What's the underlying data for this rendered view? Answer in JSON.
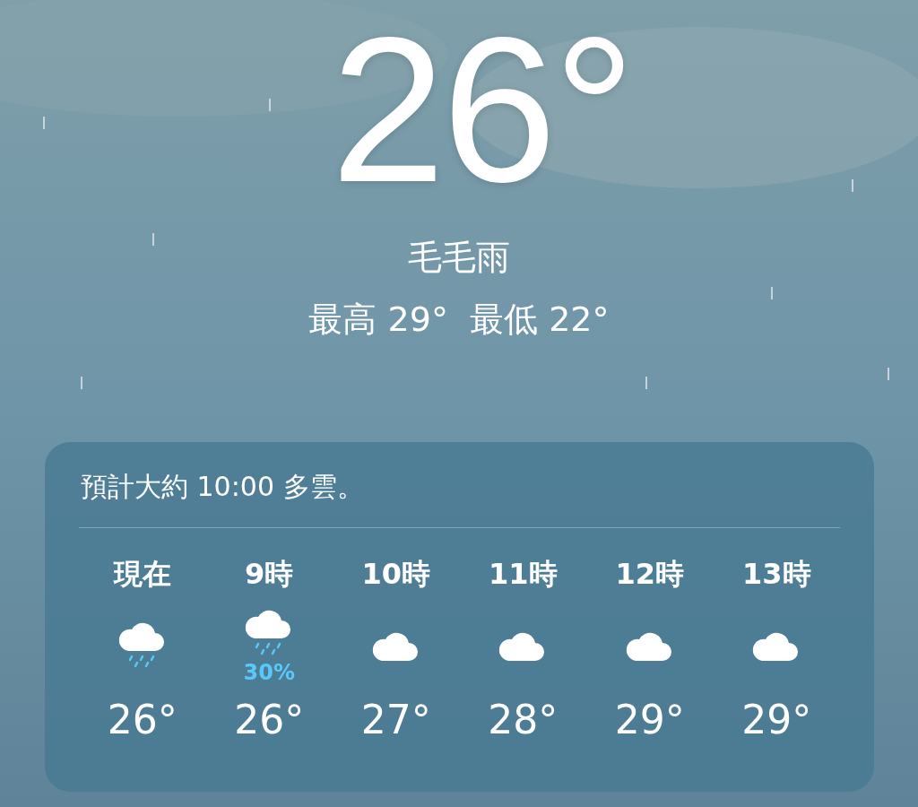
{
  "current": {
    "temperature": "26°",
    "condition": "毛毛雨",
    "high_low": "最高 29°  最低 22°"
  },
  "hourly_card": {
    "summary": "預計大約 10:00 多雲。",
    "hours": [
      {
        "label": "現在",
        "kind": "rain",
        "temperature": "26°"
      },
      {
        "label": "9時",
        "kind": "rain",
        "chance": "30%",
        "temperature": "26°"
      },
      {
        "label": "10時",
        "kind": "cloud",
        "temperature": "27°"
      },
      {
        "label": "11時",
        "kind": "cloud",
        "temperature": "28°"
      },
      {
        "label": "12時",
        "kind": "cloud",
        "temperature": "29°"
      },
      {
        "label": "13時",
        "kind": "cloud",
        "temperature": "29°"
      }
    ]
  }
}
